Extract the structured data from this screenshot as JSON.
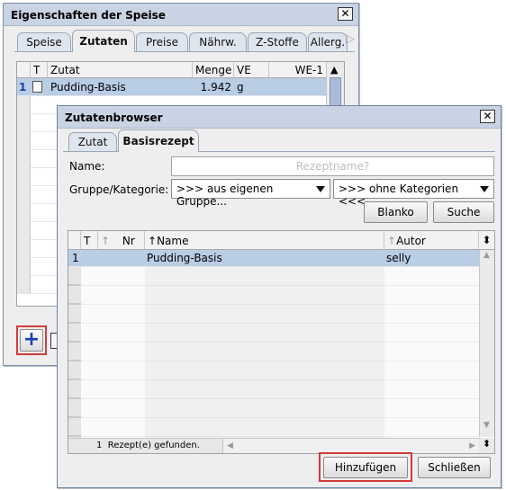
{
  "back_window": {
    "title": "Eigenschaften der Speise",
    "close": "✕",
    "tabs": [
      "Speise",
      "Zutaten",
      "Preise",
      "Nährw.",
      "Z-Stoffe",
      "Allerg."
    ],
    "active_tab_index": 1,
    "tab_scroll": "▷",
    "columns": [
      "T",
      "Zutat",
      "Menge",
      "VE",
      "WE-1"
    ],
    "rows": [
      {
        "num": "1",
        "name": "Pudding-Basis",
        "menge": "1.942",
        "ve": "g",
        "we": ""
      }
    ],
    "add_icon": "+",
    "scroll_up": "▲"
  },
  "browser": {
    "title": "Zutatenbrowser",
    "close": "✕",
    "tabs": [
      "Zutat",
      "Basisrezept"
    ],
    "active_tab_index": 1,
    "name_label": "Name:",
    "name_placeholder": "Rezeptname?",
    "group_label": "Gruppe/Kategorie:",
    "group_value": ">>> aus eigenen Gruppe...",
    "category_value": ">>> ohne Kategorien <<<",
    "blanko_label": "Blanko",
    "suche_label": "Suche",
    "columns": [
      "T",
      "Nr",
      "Name",
      "Autor"
    ],
    "rows": [
      {
        "num": "1",
        "t": "",
        "nr": "",
        "name": "Pudding-Basis",
        "autor": "selly"
      }
    ],
    "status": "1  Rezept(e) gefunden.",
    "add_label": "Hinzufügen",
    "close_label": "Schließen",
    "sort_icon": "⬍"
  }
}
